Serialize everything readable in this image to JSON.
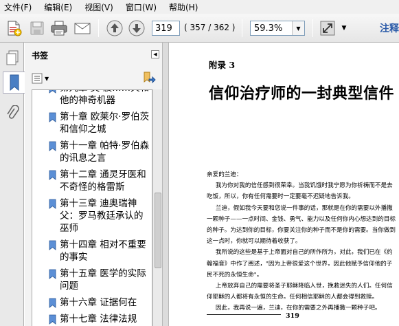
{
  "menu": {
    "file": "文件(F)",
    "edit": "编辑(E)",
    "view": "视图(V)",
    "window": "窗口(W)",
    "help": "帮助(H)"
  },
  "toolbar": {
    "current_page": "319",
    "page_count": "( 357 / 362 )",
    "zoom": "59.3%",
    "comment_label": "注释"
  },
  "panel": {
    "title": "书签"
  },
  "bookmarks": [
    {
      "label": "第九章 奥·波……夫和他的神奇机器"
    },
    {
      "label": "第十章 欧莱尔·罗伯茨和信仰之城"
    },
    {
      "label": "第十一章 帕特·罗伯森的讯息之言"
    },
    {
      "label": "第十二章 通灵牙医和不奇怪的格雷斯"
    },
    {
      "label": "第十三章 迪奥瑞神父：罗马教廷承认的巫师"
    },
    {
      "label": "第十四章 相对不重要的事实"
    },
    {
      "label": "第十五章 医学的实际问题"
    },
    {
      "label": "第十六章 证据何在"
    },
    {
      "label": "第十七章 法律法规"
    }
  ],
  "document": {
    "kicker": "附录 3",
    "title": "信仰治疗师的一封典型信件",
    "salutation": "亲爱的兰迪：",
    "paragraphs": [
      "我为你对我的信任感到很荣幸。当我饥饿时我宁愿为你祈祷而不是去吃饭，所以，你有任何需要时一定要毫不迟疑地告诉我。",
      "兰迪，假如我今天要和您说一件事的话，那就是在你的需要以外播撒一颗种子——一点时间、金钱、勇气、能力以及任何你内心想达到的目标的种子。为达到你的目标，你要关注你的种子而不是你的需要。当你做到这一点时，你就可以期待着收获了。",
      "我所说的这些是基于上帝面对自己的所作所为，对此，我们已在《约翰福音》中作了阐述，\"因为上帝很爱这个世界，因此他赋予信仰他的子民不死的永恒生命\"。",
      "上帝放弃自己的需要将圣子耶稣降临人世，挽救迷失的人们。任何信仰耶稣的人都将有永恒的生命。任何相信耶稣的人都会得到救赎。",
      "因此，我再说一遍，兰迪，在你的需要之外再播撒一颗种子吧。"
    ],
    "page_number": "319"
  }
}
